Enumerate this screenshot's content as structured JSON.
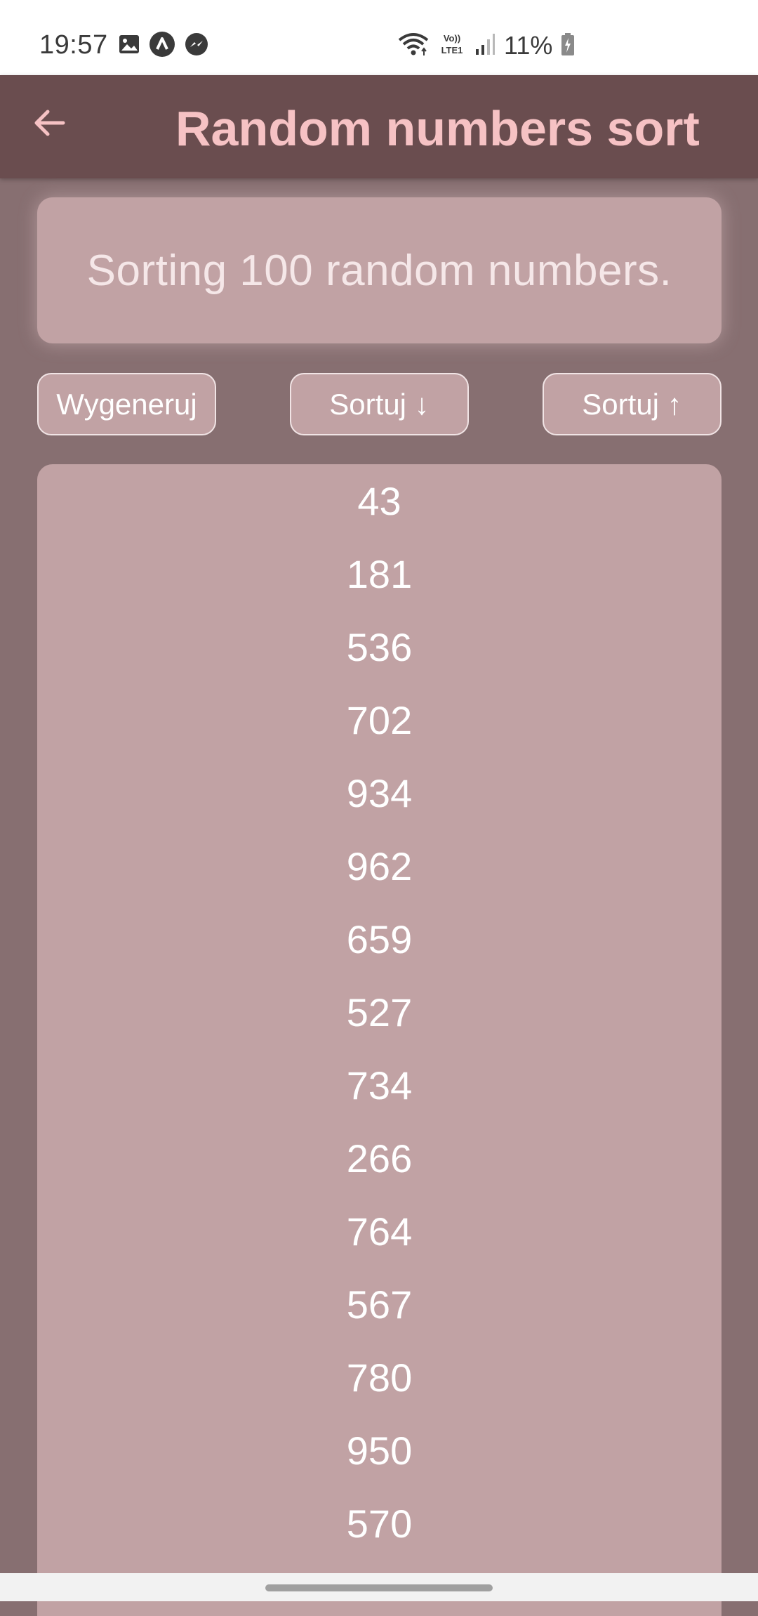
{
  "status_bar": {
    "time": "19:57",
    "battery_text": "11%",
    "left_icons": [
      "gallery-icon",
      "arrow-app-icon",
      "messenger-icon"
    ],
    "right_icons": [
      "wifi-icon",
      "volte-icon",
      "signal-icon",
      "battery-icon"
    ],
    "volte_label": "Vo)) LTE1"
  },
  "app_bar": {
    "title": "Random numbers sort",
    "back_icon": "back-arrow-icon",
    "title_color": "#f6c2c4",
    "background": "#6a4d4f"
  },
  "banner": {
    "text": "Sorting 100 random numbers."
  },
  "buttons": {
    "generate": "Wygeneruj",
    "sort_desc": "Sortuj ↓",
    "sort_asc": "Sortuj ↑"
  },
  "numbers": [
    "43",
    "181",
    "536",
    "702",
    "934",
    "962",
    "659",
    "527",
    "734",
    "266",
    "764",
    "567",
    "780",
    "950",
    "570"
  ],
  "colors": {
    "page_background": "#876f71",
    "card_background": "#c1a2a4",
    "text_light": "#ffffff"
  }
}
